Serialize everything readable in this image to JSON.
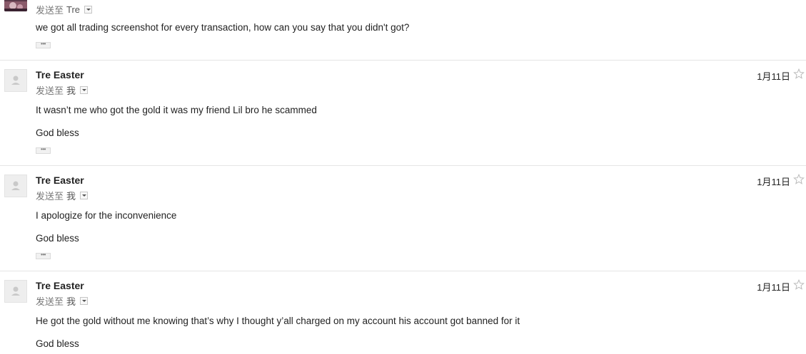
{
  "messages": [
    {
      "sender": "",
      "to_label": "发送至",
      "to_name": "Tre",
      "date": "",
      "lines": [
        "we got all trading screenshot for every transaction, how can you say that you didn't got?"
      ],
      "ellipsis": "•••"
    },
    {
      "sender": "Tre Easter",
      "to_label": "发送至",
      "to_name": "我",
      "date": "1月11日",
      "lines": [
        "It wasn’t me who got the gold it was my friend Lil bro he scammed",
        "God bless"
      ],
      "ellipsis": "•••"
    },
    {
      "sender": "Tre Easter",
      "to_label": "发送至",
      "to_name": "我",
      "date": "1月11日",
      "lines": [
        "I apologize for the inconvenience",
        "God bless"
      ],
      "ellipsis": "•••"
    },
    {
      "sender": "Tre Easter",
      "to_label": "发送至",
      "to_name": "我",
      "date": "1月11日",
      "lines": [
        "He got the gold without me knowing that’s why I thought y’all charged on my account his account got banned for it",
        "God bless"
      ],
      "ellipsis": ""
    }
  ],
  "icons": {
    "avatar": "person-silhouette-icon",
    "star": "star-outline-icon",
    "dropdown": "chevron-down-icon"
  },
  "colors": {
    "divider": "#e5e5e5",
    "star_outline": "#bbbbbb",
    "recipient_text": "#777777"
  }
}
